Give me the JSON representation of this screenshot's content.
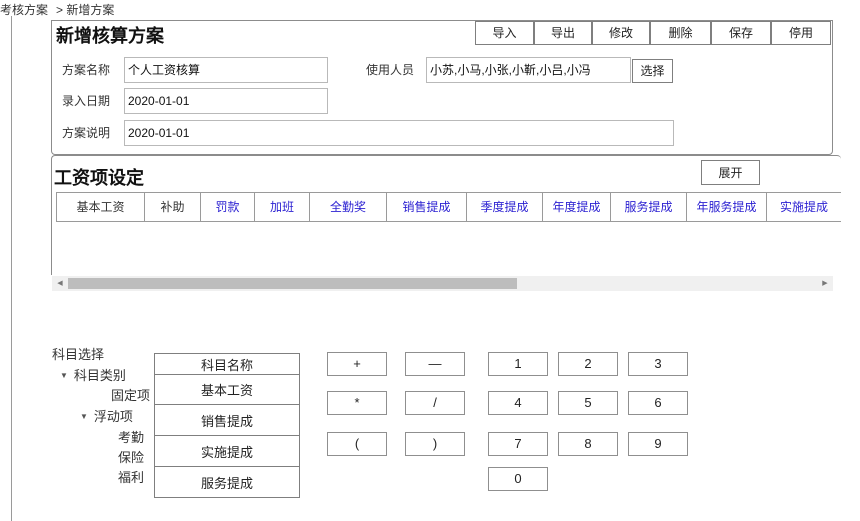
{
  "breadcrumb": {
    "root": "考核方案",
    "current": "> 新增方案"
  },
  "plan": {
    "title": "新增核算方案",
    "actions": [
      "导入",
      "导出",
      "修改",
      "删除",
      "保存",
      "停用"
    ],
    "name_label": "方案名称",
    "name_value": "个人工资核算",
    "users_label": "使用人员",
    "users_value": "小苏,小马,小张,小靳,小吕,小冯",
    "select_label": "选择",
    "date_label": "录入日期",
    "date_value": "2020-01-01",
    "desc_label": "方案说明",
    "desc_value": "2020-01-01"
  },
  "salary": {
    "title": "工资项设定",
    "expand_label": "展开",
    "columns": [
      "基本工资",
      "补助",
      "罚款",
      "加班",
      "全勤奖",
      "销售提成",
      "季度提成",
      "年度提成",
      "服务提成",
      "年服务提成",
      "实施提成"
    ],
    "column_colors": [
      "#333333",
      "#333333",
      "#2a1fd1",
      "#2a1fd1",
      "#2a1fd1",
      "#2a1fd1",
      "#2a1fd1",
      "#2a1fd1",
      "#2a1fd1",
      "#2a1fd1",
      "#2a1fd1"
    ],
    "scroll_left_icon": "arrow-left-icon",
    "scroll_right_icon": "arrow-right-icon"
  },
  "subjects": {
    "title": "科目选择",
    "category": "科目类别",
    "fixed": "固定项",
    "floating": "浮动项",
    "float_children": [
      "考勤",
      "保险",
      "福利"
    ],
    "table_header": "科目名称",
    "table_rows": [
      "基本工资",
      "销售提成",
      "实施提成",
      "服务提成"
    ]
  },
  "operators": [
    "+",
    "—",
    "*",
    "/",
    "(",
    ")"
  ],
  "digits": [
    "1",
    "2",
    "3",
    "4",
    "5",
    "6",
    "7",
    "8",
    "9",
    "0"
  ]
}
